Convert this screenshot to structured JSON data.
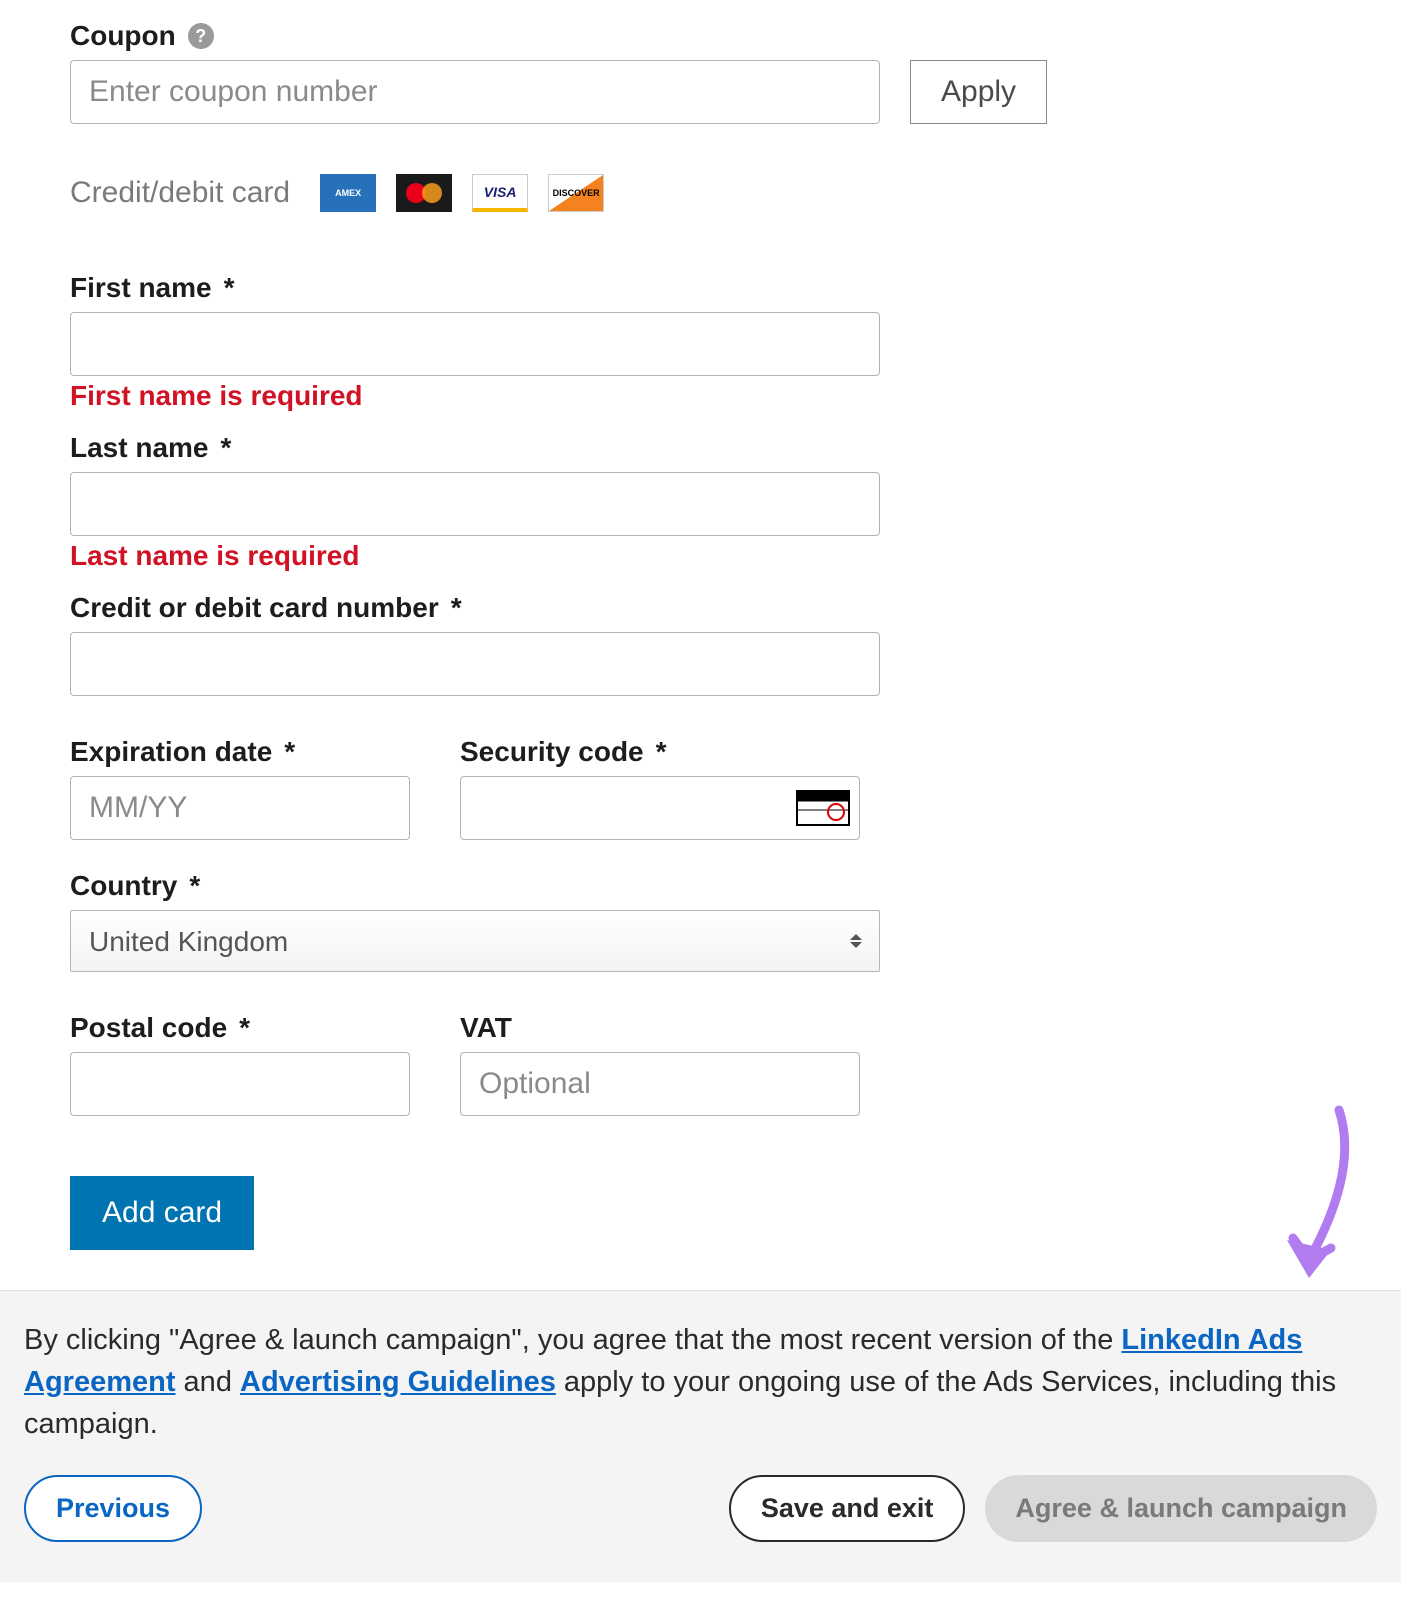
{
  "coupon": {
    "label": "Coupon",
    "placeholder": "Enter coupon number",
    "apply_label": "Apply"
  },
  "card_section": {
    "label": "Credit/debit card"
  },
  "fields": {
    "first_name": {
      "label": "First name",
      "error": "First name is required"
    },
    "last_name": {
      "label": "Last name",
      "error": "Last name is required"
    },
    "card_number": {
      "label": "Credit or debit card number"
    },
    "expiration": {
      "label": "Expiration date",
      "placeholder": "MM/YY"
    },
    "security": {
      "label": "Security code"
    },
    "country": {
      "label": "Country",
      "value": "United Kingdom"
    },
    "postal": {
      "label": "Postal code"
    },
    "vat": {
      "label": "VAT",
      "placeholder": "Optional"
    }
  },
  "add_card_label": "Add card",
  "footer": {
    "text_before": "By clicking \"Agree & launch campaign\", you agree that the most recent version of the ",
    "link1": "LinkedIn Ads Agreement",
    "text_mid": " and ",
    "link2": "Advertising Guidelines",
    "text_after": " apply to your ongoing use of the Ads Services, including this campaign.",
    "prev": "Previous",
    "save": "Save and exit",
    "launch": "Agree & launch campaign"
  },
  "required_mark": "*"
}
